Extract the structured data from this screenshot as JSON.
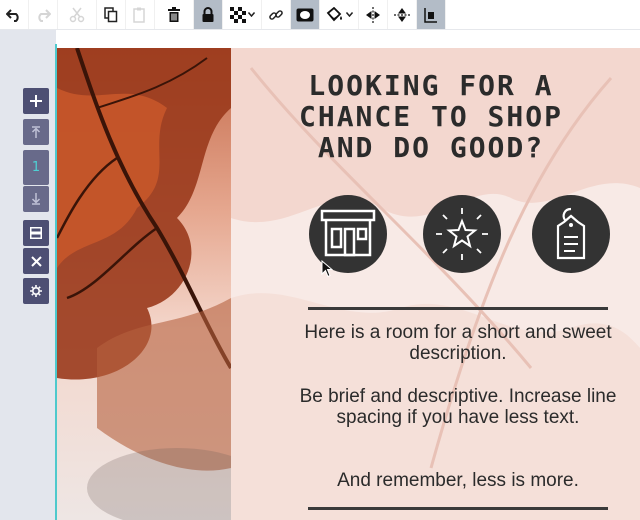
{
  "toolbar": {
    "buttons": [
      {
        "icon": "undo-icon"
      },
      {
        "icon": "redo-icon"
      },
      {
        "icon": "cut-icon"
      },
      {
        "icon": "copy-icon"
      },
      {
        "icon": "paste-icon"
      },
      {
        "icon": "trash-icon"
      },
      {
        "icon": "lock-icon"
      },
      {
        "icon": "pattern-icon"
      },
      {
        "icon": "link-icon"
      },
      {
        "icon": "mask-icon"
      },
      {
        "icon": "fill-icon"
      },
      {
        "icon": "flip-horizontal-icon"
      },
      {
        "icon": "flip-vertical-icon"
      },
      {
        "icon": "align-icon"
      }
    ]
  },
  "sidebar": {
    "page_number": "1"
  },
  "content": {
    "headline": "LOOKING FOR A CHANCE TO SHOP AND DO GOOD?",
    "icons": [
      "store-icon",
      "star-icon",
      "tag-icon"
    ],
    "description": [
      "Here is a room for a short and sweet description.",
      "Be brief and descriptive. Increase line spacing if you have less text.",
      "And remember, less is more."
    ]
  },
  "colors": {
    "accent": "#4ec9cc",
    "sidebar_button": "#4d4f73",
    "dark_circle": "#333333"
  }
}
